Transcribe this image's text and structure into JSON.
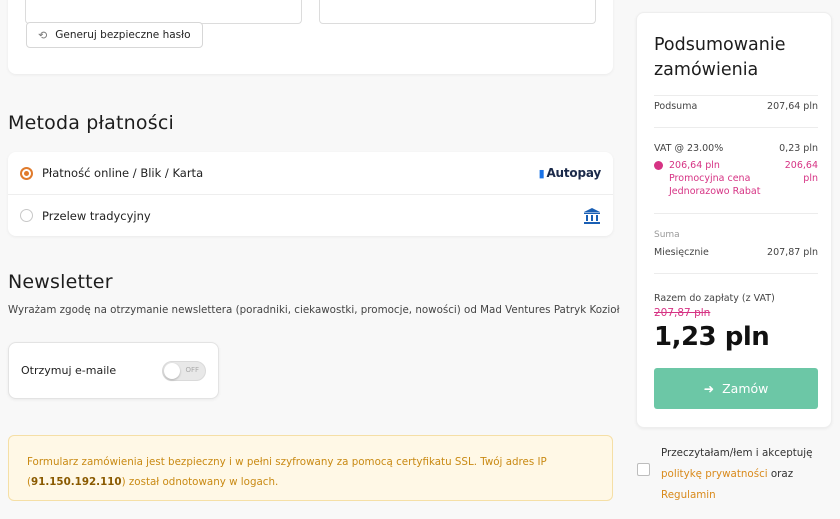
{
  "password": {
    "generate_label": "Generuj bezpieczne hasło"
  },
  "payment": {
    "title": "Metoda płatności",
    "options": [
      {
        "label": "Płatność online / Blik / Karta",
        "logo": "Autopay",
        "selected": true
      },
      {
        "label": "Przelew tradycyjny",
        "icon": "bank-icon",
        "selected": false
      }
    ]
  },
  "newsletter": {
    "title": "Newsletter",
    "description": "Wyrażam zgodę na otrzymanie newslettera (poradniki, ciekawostki, promocje, nowości) od Mad Ventures Patryk Kozioł",
    "toggle_label": "Otrzymuj e-maile",
    "toggle_state": "OFF"
  },
  "ssl_notice": {
    "text_before": "Formularz zamówienia jest bezpieczny i w pełni szyfrowany za pomocą certyfikatu SSL. Twój adres IP (",
    "ip": "91.150.192.110",
    "text_after": ") został odnotowany w logach."
  },
  "summary": {
    "title": "Podsumowanie zamówienia",
    "subtotal_label": "Podsuma",
    "subtotal_value": "207,64 pln",
    "vat_label": "VAT @ 23.00%",
    "vat_value": "0,23 pln",
    "promo_price": "206,64 pln",
    "promo_name": "Promocyjna cena Jednorazowo Rabat",
    "promo_value": "206,64 pln",
    "suma_label": "Suma",
    "monthly_label": "Miesięcznie",
    "monthly_value": "207,87 pln",
    "due_label": "Razem do zapłaty (z VAT)",
    "old_price": "207,87 pln",
    "new_price": "1,23 pln",
    "order_label": "Zamów"
  },
  "consent": {
    "text_1": "Przeczytałam/łem i akceptuję ",
    "privacy_link": "politykę prywatności",
    "text_2": " oraz ",
    "terms_link": "Regulamin"
  },
  "colors": {
    "accent_orange": "#e07b2c",
    "promo_pink": "#d63384",
    "order_green": "#6cc7a6",
    "link_orange": "#d98a1c"
  }
}
